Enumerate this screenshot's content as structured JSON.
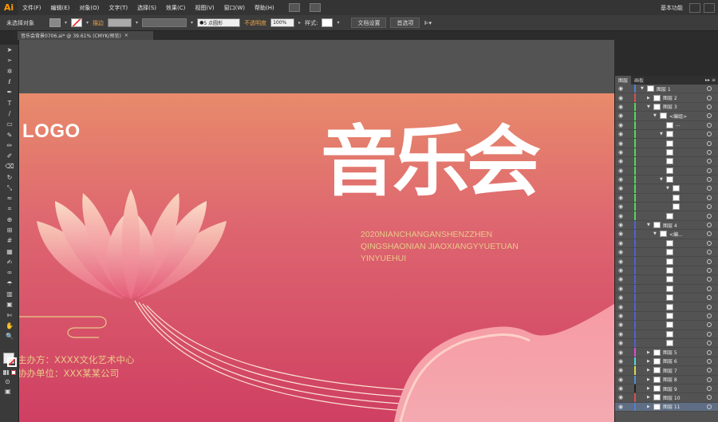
{
  "app": {
    "logo": "Ai",
    "menu": [
      "文件(F)",
      "编辑(E)",
      "对象(O)",
      "文字(T)",
      "选择(S)",
      "效果(C)",
      "视图(V)",
      "窗口(W)",
      "帮助(H)"
    ],
    "workspace": "基本功能"
  },
  "control_bar": {
    "selection_status": "未选择对象",
    "stroke_label": "描边",
    "brush_value": "5 点圆形",
    "opacity_label": "不透明度",
    "opacity_value": "100%",
    "style_label": "样式:",
    "doc_setup_button": "文档设置",
    "preferences_button": "首选项"
  },
  "document_tab": {
    "title": "音乐会背景0706.ai* @ 39.61% (CMYK/预览)",
    "close": "×"
  },
  "toolbar": {
    "tools": [
      "selection-tool",
      "direct-selection-tool",
      "magic-wand-tool",
      "lasso-tool",
      "pen-tool",
      "type-tool",
      "line-tool",
      "rectangle-tool",
      "paintbrush-tool",
      "pencil-tool",
      "blob-brush-tool",
      "eraser-tool",
      "rotate-tool",
      "scale-tool",
      "width-tool",
      "free-transform-tool",
      "shape-builder-tool",
      "perspective-grid-tool",
      "mesh-tool",
      "gradient-tool",
      "eyedropper-tool",
      "blend-tool",
      "symbol-sprayer-tool",
      "column-graph-tool",
      "artboard-tool",
      "slice-tool",
      "hand-tool",
      "zoom-tool"
    ],
    "glyphs": [
      "➤",
      "➢",
      "✲",
      "ℓ",
      "✒",
      "T",
      "/",
      "▭",
      "✎",
      "✏",
      "✐",
      "⌫",
      "↻",
      "⤡",
      "≈",
      "⌗",
      "⊕",
      "⊞",
      "#",
      "▦",
      "✍",
      "∞",
      "☂",
      "▥",
      "▣",
      "✄",
      "✋",
      "🔍"
    ]
  },
  "artwork": {
    "logo_text": "LOGO",
    "title": "音乐会",
    "subtitle_lines": [
      "2020NIANCHANGANSHENZZHEN",
      "QINGSHAONIAN JIAOXIANGYYUETUAN",
      "YINYUEHUI"
    ],
    "organizer": "主办方：XXXX文化艺术中心",
    "co_organizer": "协办单位：XXX某某公司",
    "colors": {
      "bg_top": "#e6896c",
      "bg_mid": "#d9556a",
      "bg_bottom": "#c93a5b",
      "gold_text": "#e8c987",
      "white": "#ffffff"
    }
  },
  "layers_panel": {
    "tabs": [
      "图层",
      "画板"
    ],
    "menu": "▸▸ ≡",
    "rows": [
      {
        "name": "图层 1",
        "level": 0,
        "twirl": "down",
        "color": "#4f7fd8"
      },
      {
        "name": "图层 2",
        "level": 1,
        "twirl": "right",
        "color": "#d84f4f"
      },
      {
        "name": "图层 3",
        "level": 1,
        "twirl": "down",
        "color": "#4fd85a"
      },
      {
        "name": "<编组>",
        "level": 2,
        "twirl": "down",
        "color": "#4fd85a"
      },
      {
        "name": "...",
        "level": 3,
        "twirl": "",
        "color": "#4fd85a"
      },
      {
        "name": "",
        "level": 3,
        "twirl": "down",
        "color": "#4fd85a"
      },
      {
        "name": "",
        "level": 3,
        "twirl": "",
        "color": "#4fd85a"
      },
      {
        "name": "",
        "level": 3,
        "twirl": "",
        "color": "#4fd85a"
      },
      {
        "name": "",
        "level": 3,
        "twirl": "",
        "color": "#4fd85a"
      },
      {
        "name": "",
        "level": 3,
        "twirl": "",
        "color": "#4fd85a"
      },
      {
        "name": "",
        "level": 3,
        "twirl": "down",
        "color": "#4fd85a"
      },
      {
        "name": "",
        "level": 4,
        "twirl": "down",
        "color": "#4fd85a"
      },
      {
        "name": "",
        "level": 4,
        "twirl": "",
        "color": "#4fd85a"
      },
      {
        "name": "",
        "level": 4,
        "twirl": "",
        "color": "#4fd85a"
      },
      {
        "name": "",
        "level": 3,
        "twirl": "",
        "color": "#4fd85a"
      },
      {
        "name": "图层 4",
        "level": 1,
        "twirl": "down",
        "color": "#4f5fd8"
      },
      {
        "name": "<编...",
        "level": 2,
        "twirl": "down",
        "color": "#4f5fd8"
      },
      {
        "name": "",
        "level": 3,
        "twirl": "",
        "color": "#4f5fd8"
      },
      {
        "name": "",
        "level": 3,
        "twirl": "",
        "color": "#4f5fd8"
      },
      {
        "name": "",
        "level": 3,
        "twirl": "",
        "color": "#4f5fd8"
      },
      {
        "name": "",
        "level": 3,
        "twirl": "",
        "color": "#4f5fd8"
      },
      {
        "name": "",
        "level": 3,
        "twirl": "",
        "color": "#4f5fd8"
      },
      {
        "name": "",
        "level": 3,
        "twirl": "",
        "color": "#4f5fd8"
      },
      {
        "name": "",
        "level": 3,
        "twirl": "",
        "color": "#4f5fd8"
      },
      {
        "name": "",
        "level": 3,
        "twirl": "",
        "color": "#4f5fd8"
      },
      {
        "name": "",
        "level": 3,
        "twirl": "",
        "color": "#4f5fd8"
      },
      {
        "name": "",
        "level": 3,
        "twirl": "",
        "color": "#4f5fd8"
      },
      {
        "name": "",
        "level": 3,
        "twirl": "",
        "color": "#4f5fd8"
      },
      {
        "name": "",
        "level": 3,
        "twirl": "",
        "color": "#4f5fd8"
      },
      {
        "name": "图层 5",
        "level": 1,
        "twirl": "right",
        "color": "#d84fd0"
      },
      {
        "name": "图层 6",
        "level": 1,
        "twirl": "right",
        "color": "#4fd8d0"
      },
      {
        "name": "图层 7",
        "level": 1,
        "twirl": "right",
        "color": "#d8d84f"
      },
      {
        "name": "图层 8",
        "level": 1,
        "twirl": "right",
        "color": "#4f8fd8"
      },
      {
        "name": "图层 9",
        "level": 1,
        "twirl": "right",
        "color": "#222222"
      },
      {
        "name": "图层 10",
        "level": 1,
        "twirl": "right",
        "color": "#d84f4f"
      },
      {
        "name": "图层 11",
        "level": 1,
        "twirl": "right",
        "color": "#4f7fd8"
      }
    ]
  }
}
